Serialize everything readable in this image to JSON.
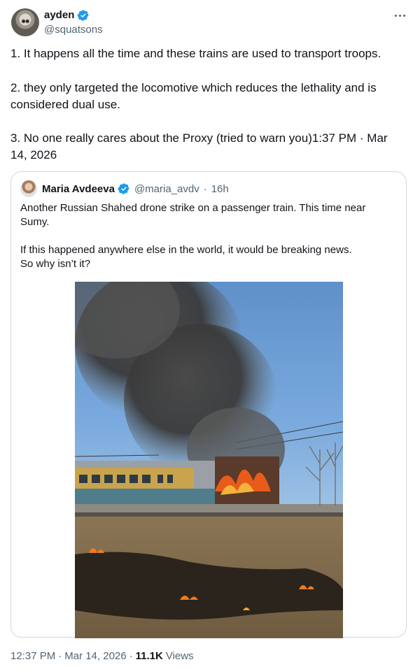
{
  "author": {
    "name": "ayden",
    "handle": "@squatsons",
    "verified_icon": "verified-badge-icon",
    "more_icon": "more-options-icon"
  },
  "tweet": {
    "p1": "1. It happens all the time and these trains are used to transport troops.",
    "p2": "2. they only targeted the locomotive which reduces the lethality and is considered dual use.",
    "p3": "3. No one really cares about the Proxy (tried to warn you)1:37 PM · Mar 14, 2026"
  },
  "quote": {
    "name": "Maria Avdeeva",
    "handle": "@maria_avdv",
    "separator": "·",
    "age": "16h",
    "text1": "Another Russian Shahed drone strike on a passenger train. This time near Sumy.",
    "text2_line1": "If this happened anywhere else in the world, it would be breaking news.",
    "text2_line2": "So why isn’t it?",
    "image_description_icon": "burning-train-photo"
  },
  "footer": {
    "time": "12:37 PM",
    "sep1": "·",
    "date": "Mar 14, 2026",
    "sep2": "·",
    "views_count": "11.1K",
    "views_label": "Views"
  },
  "colors": {
    "verified": "#1d9bf0",
    "secondary_text": "#536471",
    "border": "#cfd9de"
  }
}
